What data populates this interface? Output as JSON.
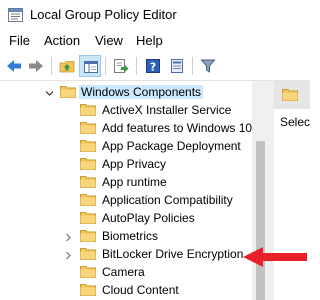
{
  "window": {
    "title": "Local Group Policy Editor"
  },
  "menu": {
    "items": [
      "File",
      "Action",
      "View",
      "Help"
    ]
  },
  "tree": {
    "parent": {
      "label": "Windows Components",
      "expanded": true
    },
    "children": [
      {
        "label": "ActiveX Installer Service",
        "expandable": false
      },
      {
        "label": "Add features to Windows 10",
        "expandable": false
      },
      {
        "label": "App Package Deployment",
        "expandable": false
      },
      {
        "label": "App Privacy",
        "expandable": false
      },
      {
        "label": "App runtime",
        "expandable": false
      },
      {
        "label": "Application Compatibility",
        "expandable": false
      },
      {
        "label": "AutoPlay Policies",
        "expandable": false
      },
      {
        "label": "Biometrics",
        "expandable": true
      },
      {
        "label": "BitLocker Drive Encryption",
        "expandable": true
      },
      {
        "label": "Camera",
        "expandable": false
      },
      {
        "label": "Cloud Content",
        "expandable": false
      }
    ]
  },
  "detail": {
    "text": "Select"
  },
  "icons": {
    "toolbar": [
      "back-arrow-icon",
      "forward-arrow-icon",
      "up-folder-icon",
      "show-hide-tree-icon",
      "export-list-icon",
      "help-icon",
      "properties-icon",
      "filter-icon"
    ]
  },
  "colors": {
    "folder": "#f2c55c",
    "selection": "#cce8ff",
    "annotation_arrow": "#e8202a",
    "toolbar_pressed": "#cce4f7"
  }
}
